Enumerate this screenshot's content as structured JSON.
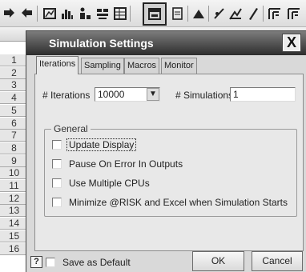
{
  "toolbar": {
    "buttons": [
      {
        "icon": "arrow-swap-icon"
      },
      {
        "icon": "arrow-swap-reverse-icon"
      },
      {
        "icon": "browse-results-icon"
      },
      {
        "icon": "histogram-icon"
      },
      {
        "icon": "scatter-people-icon"
      },
      {
        "icon": "ranking-icon"
      },
      {
        "icon": "data-table-icon"
      },
      {
        "icon": "simulation-settings-icon"
      },
      {
        "icon": "report-icon"
      },
      {
        "icon": "triangle-distribution-icon"
      },
      {
        "icon": "fitting-icon"
      },
      {
        "icon": "distribution-fit-icon"
      },
      {
        "icon": "pencil-icon"
      },
      {
        "icon": "export-icon"
      },
      {
        "icon": "export-alt-icon"
      }
    ]
  },
  "sheet": {
    "rows": [
      "1",
      "2",
      "3",
      "4",
      "5",
      "6",
      "7",
      "8",
      "9",
      "10",
      "11",
      "12",
      "13",
      "14",
      "15",
      "16"
    ]
  },
  "dialog": {
    "title": "Simulation Settings",
    "close_label": "X",
    "tabs": [
      "Iterations",
      "Sampling",
      "Macros",
      "Monitor"
    ],
    "iterations_label": "# Iterations",
    "iterations_value": "10000",
    "simulations_label": "# Simulations",
    "simulations_value": "1",
    "general_label": "General",
    "options": [
      "Update Display",
      "Pause On Error In Outputs",
      "Use Multiple CPUs",
      "Minimize @RISK and Excel when Simulation Starts"
    ],
    "help_label": "?",
    "save_default_label": "Save as Default",
    "ok_label": "OK",
    "cancel_label": "Cancel"
  }
}
